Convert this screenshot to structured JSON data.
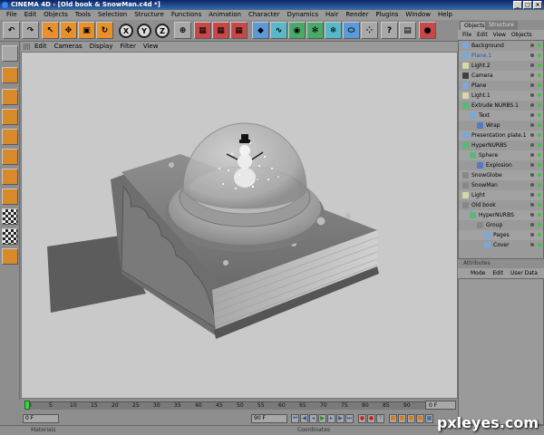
{
  "title": "CINEMA 4D - [Old book & SnowMan.c4d *]",
  "menu": [
    "File",
    "Edit",
    "Objects",
    "Tools",
    "Selection",
    "Structure",
    "Functions",
    "Animation",
    "Character",
    "Dynamics",
    "Hair",
    "Render",
    "Plugins",
    "Window",
    "Help"
  ],
  "toolbar": {
    "axis_x": "X",
    "axis_y": "Y",
    "axis_z": "Z"
  },
  "viewport_menu": [
    "Edit",
    "Cameras",
    "Display",
    "Filter",
    "View"
  ],
  "panel": {
    "tabs": [
      "Objects",
      "Structure"
    ],
    "menu": [
      "File",
      "Edit",
      "View",
      "Objects"
    ],
    "objects": [
      {
        "label": "Background",
        "indent": 0,
        "color": "#7aa8d8"
      },
      {
        "label": "Plane.1",
        "indent": 0,
        "color": "#7aa8d8",
        "selected": true
      },
      {
        "label": "Light.2",
        "indent": 0,
        "color": "#d8d8a8"
      },
      {
        "label": "Camera",
        "indent": 0,
        "color": "#404040"
      },
      {
        "label": "Plane",
        "indent": 0,
        "color": "#7aa8d8"
      },
      {
        "label": "Light.1",
        "indent": 0,
        "color": "#d8d8a8"
      },
      {
        "label": "Extrude NURBS.1",
        "indent": 0,
        "color": "#58b878"
      },
      {
        "label": "Text",
        "indent": 1,
        "color": "#7aa8d8"
      },
      {
        "label": "Wrap",
        "indent": 2,
        "color": "#5878c8"
      },
      {
        "label": "Presentation plate.1",
        "indent": 0,
        "color": "#7aa8d8"
      },
      {
        "label": "HyperNURBS",
        "indent": 0,
        "color": "#58b878"
      },
      {
        "label": "Sphere",
        "indent": 1,
        "color": "#58b878"
      },
      {
        "label": "Explosion",
        "indent": 2,
        "color": "#5878c8"
      },
      {
        "label": "SnowGlobe",
        "indent": 0,
        "color": "#888888"
      },
      {
        "label": "SnowMan",
        "indent": 0,
        "color": "#888888"
      },
      {
        "label": "Light",
        "indent": 0,
        "color": "#d8d8a8"
      },
      {
        "label": "Old book",
        "indent": 0,
        "color": "#888888"
      },
      {
        "label": "HyperNURBS",
        "indent": 1,
        "color": "#58b878"
      },
      {
        "label": "Group",
        "indent": 2,
        "color": "#888888"
      },
      {
        "label": "Pages",
        "indent": 3,
        "color": "#7aa8d8"
      },
      {
        "label": "Cover",
        "indent": 3,
        "color": "#7aa8d8"
      }
    ]
  },
  "attributes": {
    "header": "Attributes",
    "menu": [
      "Mode",
      "Edit",
      "User Data"
    ]
  },
  "timeline": {
    "ticks": [
      "0",
      "5",
      "10",
      "15",
      "20",
      "25",
      "30",
      "35",
      "40",
      "45",
      "50",
      "55",
      "60",
      "65",
      "70",
      "75",
      "80",
      "85",
      "90"
    ],
    "end_field": "0 F"
  },
  "transport": {
    "start_field": "0 F",
    "end_field": "90 F"
  },
  "bottom": {
    "materials": "Materials",
    "coordinates": "Coordinates"
  },
  "watermark": "pxleyes.com"
}
